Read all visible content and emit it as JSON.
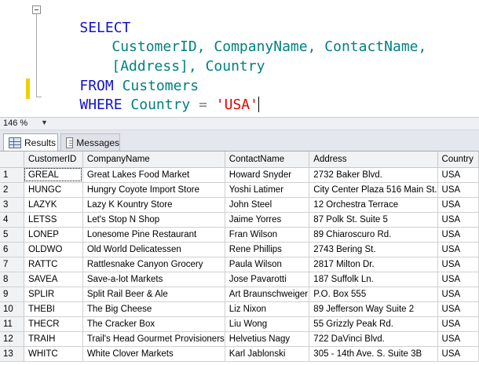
{
  "editor": {
    "lines": [
      {
        "kw": "SELECT"
      },
      {
        "cols": "CustomerID, CompanyName, ContactName,"
      },
      {
        "cols": "[Address], Country"
      },
      {
        "kw": "FROM",
        "table": "Customers"
      },
      {
        "kw": "WHERE",
        "col": "Country",
        "op": "=",
        "str": "'USA'"
      }
    ]
  },
  "zoom": {
    "value": "146 %"
  },
  "tabs": [
    {
      "label": "Results",
      "icon": "grid-icon"
    },
    {
      "label": "Messages",
      "icon": "message-icon"
    }
  ],
  "grid": {
    "columns": [
      "CustomerID",
      "CompanyName",
      "ContactName",
      "Address",
      "Country"
    ],
    "rows": [
      [
        "1",
        "GREAL",
        "Great Lakes Food Market",
        "Howard Snyder",
        "2732 Baker Blvd.",
        "USA"
      ],
      [
        "2",
        "HUNGC",
        "Hungry Coyote Import Store",
        "Yoshi Latimer",
        "City Center Plaza 516 Main St.",
        "USA"
      ],
      [
        "3",
        "LAZYK",
        "Lazy K Kountry Store",
        "John Steel",
        "12 Orchestra Terrace",
        "USA"
      ],
      [
        "4",
        "LETSS",
        "Let's Stop N Shop",
        "Jaime Yorres",
        "87 Polk St. Suite 5",
        "USA"
      ],
      [
        "5",
        "LONEP",
        "Lonesome Pine Restaurant",
        "Fran Wilson",
        "89 Chiaroscuro Rd.",
        "USA"
      ],
      [
        "6",
        "OLDWO",
        "Old World Delicatessen",
        "Rene Phillips",
        "2743 Bering St.",
        "USA"
      ],
      [
        "7",
        "RATTC",
        "Rattlesnake Canyon Grocery",
        "Paula Wilson",
        "2817 Milton Dr.",
        "USA"
      ],
      [
        "8",
        "SAVEA",
        "Save-a-lot Markets",
        "Jose Pavarotti",
        "187 Suffolk Ln.",
        "USA"
      ],
      [
        "9",
        "SPLIR",
        "Split Rail Beer & Ale",
        "Art Braunschweiger",
        "P.O. Box 555",
        "USA"
      ],
      [
        "10",
        "THEBI",
        "The Big Cheese",
        "Liz Nixon",
        "89 Jefferson Way Suite 2",
        "USA"
      ],
      [
        "11",
        "THECR",
        "The Cracker Box",
        "Liu Wong",
        "55 Grizzly Peak Rd.",
        "USA"
      ],
      [
        "12",
        "TRAIH",
        "Trail's Head Gourmet Provisioners",
        "Helvetius Nagy",
        "722 DaVinci Blvd.",
        "USA"
      ],
      [
        "13",
        "WHITC",
        "White Clover Markets",
        "Karl Jablonski",
        "305 - 14th Ave. S. Suite 3B",
        "USA"
      ]
    ]
  }
}
